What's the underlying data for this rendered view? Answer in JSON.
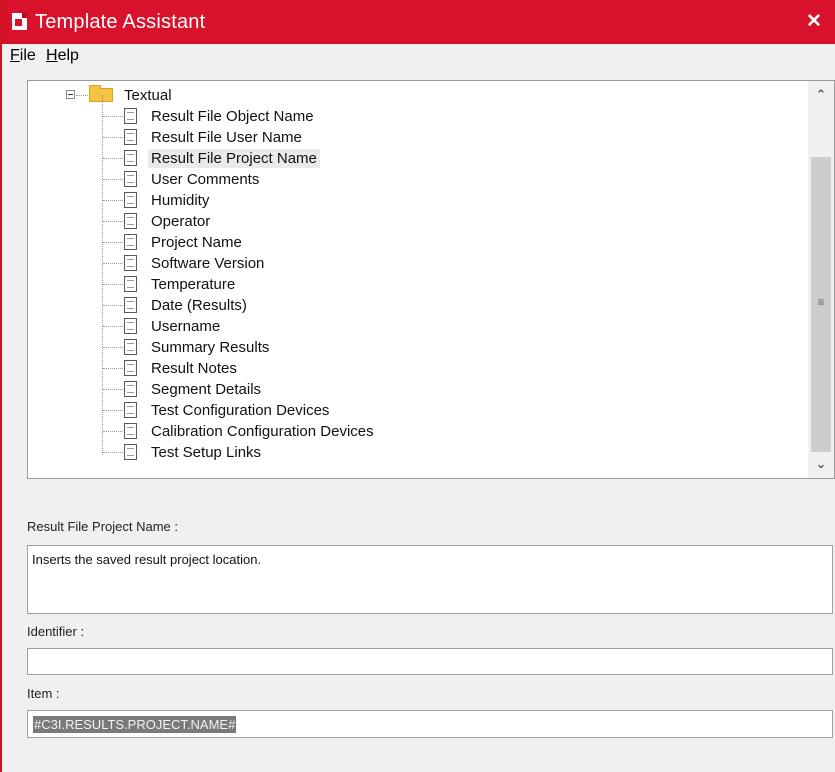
{
  "window": {
    "title": "Template Assistant",
    "close_glyph": "✕",
    "accent_color": "#d9122b"
  },
  "menu": {
    "items": [
      {
        "label": "File",
        "mnemonic": "F",
        "rest": "ile"
      },
      {
        "label": "Help",
        "mnemonic": "H",
        "rest": "elp"
      }
    ]
  },
  "tree": {
    "group": {
      "label": "Textual",
      "icon": "folder-icon",
      "expanded": true
    },
    "items": [
      {
        "label": "Result File Object Name",
        "selected": false
      },
      {
        "label": "Result File User Name",
        "selected": false
      },
      {
        "label": "Result File Project Name",
        "selected": true
      },
      {
        "label": "User Comments",
        "selected": false
      },
      {
        "label": "Humidity",
        "selected": false
      },
      {
        "label": "Operator",
        "selected": false
      },
      {
        "label": "Project Name",
        "selected": false
      },
      {
        "label": "Software Version",
        "selected": false
      },
      {
        "label": "Temperature",
        "selected": false
      },
      {
        "label": "Date (Results)",
        "selected": false
      },
      {
        "label": "Username",
        "selected": false
      },
      {
        "label": "Summary Results",
        "selected": false
      },
      {
        "label": "Result Notes",
        "selected": false
      },
      {
        "label": "Segment Details",
        "selected": false
      },
      {
        "label": "Test Configuration Devices",
        "selected": false
      },
      {
        "label": "Calibration Configuration Devices",
        "selected": false
      },
      {
        "label": "Test Setup Links",
        "selected": false
      }
    ],
    "scroll": {
      "up_glyph": "⌃",
      "down_glyph": "⌄",
      "grip_glyph": "≡"
    }
  },
  "details": {
    "description_label": "Result File Project Name :",
    "description_value": "Inserts the saved result project location.",
    "identifier_label": "Identifier :",
    "identifier_value": "",
    "item_label": "Item :",
    "item_value": "#C3I.RESULTS.PROJECT.NAME#"
  }
}
